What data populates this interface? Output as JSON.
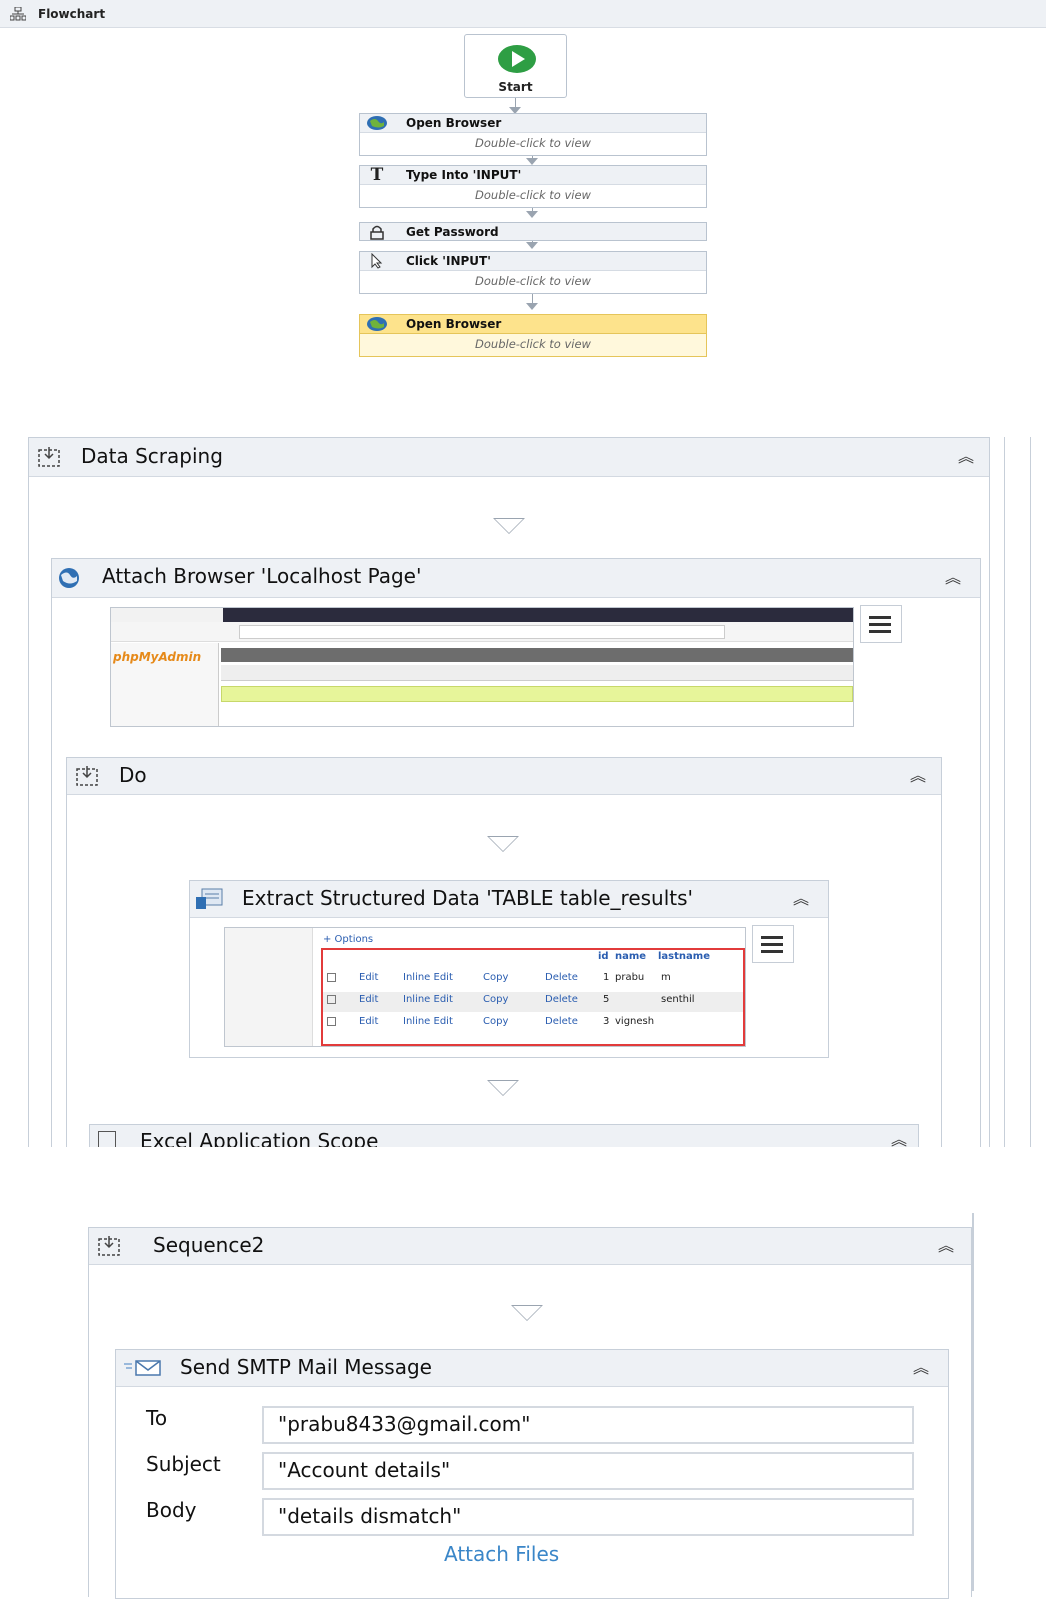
{
  "flowchart": {
    "title": "Flowchart",
    "start_label": "Start",
    "hint": "Double-click to view",
    "nodes": [
      {
        "label": "Open Browser",
        "icon": "globe-icon",
        "has_hint": true
      },
      {
        "label": "Type Into 'INPUT'",
        "icon": "type-into-icon",
        "has_hint": true
      },
      {
        "label": "Get Password",
        "icon": "lock-icon",
        "has_hint": false
      },
      {
        "label": "Click 'INPUT'",
        "icon": "cursor-icon",
        "has_hint": true
      },
      {
        "label": "Open Browser",
        "icon": "globe-icon",
        "has_hint": true,
        "selected": true
      }
    ]
  },
  "data_scraping": {
    "title": "Data Scraping",
    "attach_browser": {
      "title": "Attach Browser 'Localhost Page'",
      "thumb_text": {
        "brand": "phpMyAdmin"
      }
    },
    "do": {
      "title": "Do",
      "extract": {
        "title": "Extract Structured Data 'TABLE  table_results'",
        "thumb": {
          "options": "+ Options",
          "headers": [
            "id",
            "name",
            "lastname"
          ],
          "rows": [
            {
              "id": "1",
              "name": "prabu",
              "lastname": "m"
            },
            {
              "id": "5",
              "name": "",
              "lastname": "senthil"
            },
            {
              "id": "3",
              "name": "vignesh",
              "lastname": ""
            }
          ],
          "actions": [
            "Edit",
            "Inline Edit",
            "Copy",
            "Delete"
          ]
        }
      },
      "next_activity": "Excel Application Scope"
    }
  },
  "sequence2": {
    "title": "Sequence2",
    "smtp": {
      "title": "Send SMTP Mail Message",
      "fields": [
        {
          "label": "To",
          "value": "\"prabu8433@gmail.com\""
        },
        {
          "label": "Subject",
          "value": "\"Account details\""
        },
        {
          "label": "Body",
          "value": "\"details dismatch\""
        }
      ],
      "attach_files": "Attach Files"
    }
  },
  "colors": {
    "start_green": "#2e9e44",
    "selected_fill": "#fff8dc",
    "link_blue": "#3a86c8"
  }
}
